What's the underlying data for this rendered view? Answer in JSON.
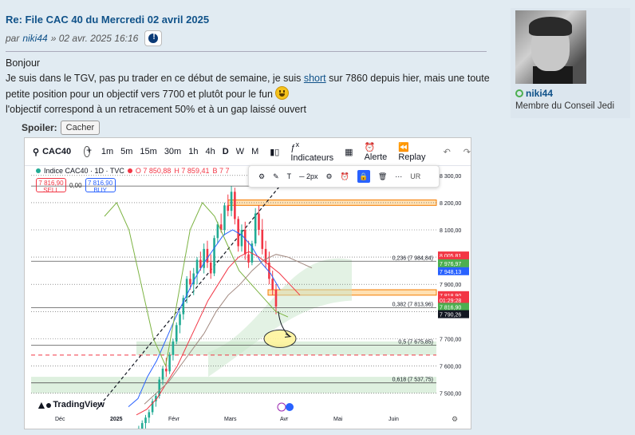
{
  "post": {
    "title": "Re: File CAC 40 du Mercredi 02 avril 2025",
    "by": "par",
    "author": "niki44",
    "date": "» 02 avr. 2025 16:16",
    "line1": "Bonjour",
    "line2a": "Je suis dans le TGV, pas pu trader en ce début de semaine, je suis",
    "line2_link": "short",
    "line2b": "sur 7860 depuis hier, mais une toute",
    "line3": "petite position pour un objectif vers 7700 et plutôt pour le fun",
    "line4": "l'objectif correspond à un retracement 50% et à un gap laissé ouvert",
    "spoiler_label": "Spoiler:",
    "spoiler_button": "Cacher"
  },
  "profile": {
    "name": "niki44",
    "rank": "Membre du Conseil Jedi"
  },
  "tv": {
    "symbol": "CAC40",
    "timeframes": [
      "1m",
      "5m",
      "15m",
      "30m",
      "1h",
      "4h",
      "D",
      "W",
      "M"
    ],
    "indicators": "Indicateurs",
    "alert": "Alerte",
    "replay": "Replay",
    "legend_name": "Indice CAC40 · 1D · TVC",
    "legend_o": "O 7 850,88",
    "legend_h": "H 7 859,41",
    "legend_b": "B 7 7",
    "sell_price": "7 816,90",
    "sell_label": "SELL",
    "spread": "0,00",
    "buy_price": "7 816,90",
    "buy_label": "BUY",
    "draw_size": "2px",
    "currency": "UR",
    "watermark": "TradingView"
  },
  "chart_data": {
    "type": "candlestick",
    "x_labels": [
      "Déc",
      "2025",
      "Févr",
      "Mars",
      "Avr",
      "Mai",
      "Juin"
    ],
    "y_ticks": [
      7500,
      7600,
      7700,
      7800,
      7900,
      8000,
      8100,
      8200,
      8300
    ],
    "y_tick_labels": [
      "7 500,00",
      "7 600,00",
      "7 700,00",
      "7 800,00",
      "7 900,00",
      "8 000,00",
      "8 100,00",
      "8 200,00",
      "8 300,00"
    ],
    "ylim": [
      7440,
      8320
    ],
    "fib_levels": [
      {
        "label": "0 (8 261,05)",
        "value": 8261.05
      },
      {
        "label": "0,236 (7 984,84)",
        "value": 7984.84
      },
      {
        "label": "0,382 (7 813,96)",
        "value": 7813.96
      },
      {
        "label": "0,5 (7 675,85)",
        "value": 7675.85
      },
      {
        "label": "0,618 (7 537,75)",
        "value": 7537.75
      }
    ],
    "price_badges": [
      {
        "label": "8 005,81",
        "value": 8005.81,
        "color": "#f23645"
      },
      {
        "label": "7 985,57",
        "value": 7985.57,
        "color": "#f23645"
      },
      {
        "label": "7 976,97",
        "value": 7976.97,
        "color": "#4caf50"
      },
      {
        "label": "7 948,13",
        "value": 7948.13,
        "color": "#2962ff"
      },
      {
        "label": "7 818,90",
        "value": 7860,
        "color": "#f23645"
      },
      {
        "label": "01:29:28",
        "value": 7842,
        "color": "#f23645"
      },
      {
        "label": "7 816,90",
        "value": 7817,
        "color": "#4caf50"
      },
      {
        "label": "7 790,26",
        "value": 7790.26,
        "color": "#131722"
      }
    ],
    "candles": [
      [
        7300,
        7330,
        7280,
        7320
      ],
      [
        7320,
        7350,
        7300,
        7340
      ],
      [
        7340,
        7360,
        7320,
        7330
      ],
      [
        7330,
        7380,
        7320,
        7370
      ],
      [
        7370,
        7400,
        7350,
        7390
      ],
      [
        7390,
        7420,
        7370,
        7410
      ],
      [
        7410,
        7440,
        7390,
        7430
      ],
      [
        7430,
        7480,
        7420,
        7470
      ],
      [
        7470,
        7500,
        7450,
        7490
      ],
      [
        7490,
        7560,
        7480,
        7550
      ],
      [
        7550,
        7600,
        7530,
        7590
      ],
      [
        7590,
        7630,
        7560,
        7580
      ],
      [
        7580,
        7650,
        7570,
        7640
      ],
      [
        7640,
        7700,
        7620,
        7690
      ],
      [
        7690,
        7760,
        7680,
        7750
      ],
      [
        7750,
        7800,
        7720,
        7790
      ],
      [
        7790,
        7860,
        7770,
        7850
      ],
      [
        7850,
        7930,
        7830,
        7920
      ],
      [
        7920,
        7950,
        7880,
        7900
      ],
      [
        7900,
        7960,
        7860,
        7940
      ],
      [
        7940,
        8000,
        7900,
        7990
      ],
      [
        7990,
        8020,
        7950,
        7960
      ],
      [
        7960,
        8050,
        7940,
        8030
      ],
      [
        8030,
        8060,
        7960,
        7980
      ],
      [
        7980,
        8010,
        7920,
        7940
      ],
      [
        7940,
        8080,
        7930,
        8070
      ],
      [
        8070,
        8130,
        8050,
        8120
      ],
      [
        8120,
        8160,
        8090,
        8100
      ],
      [
        8100,
        8200,
        8080,
        8190
      ],
      [
        8190,
        8230,
        8150,
        8170
      ],
      [
        8170,
        8260,
        8150,
        8240
      ],
      [
        8240,
        8255,
        8120,
        8140
      ],
      [
        8140,
        8150,
        8020,
        8040
      ],
      [
        8040,
        8120,
        8020,
        8100
      ],
      [
        8100,
        8130,
        7990,
        8010
      ],
      [
        8010,
        8060,
        7960,
        7980
      ],
      [
        7980,
        8060,
        7970,
        8050
      ],
      [
        8050,
        8180,
        8040,
        8160
      ],
      [
        8160,
        8190,
        8080,
        8100
      ],
      [
        8100,
        8140,
        8010,
        8030
      ],
      [
        8030,
        8060,
        7960,
        7980
      ],
      [
        7980,
        8020,
        7900,
        7920
      ],
      [
        7920,
        7950,
        7860,
        7880
      ],
      [
        7880,
        7900,
        7790,
        7818
      ]
    ],
    "annotation_target": 7700
  }
}
